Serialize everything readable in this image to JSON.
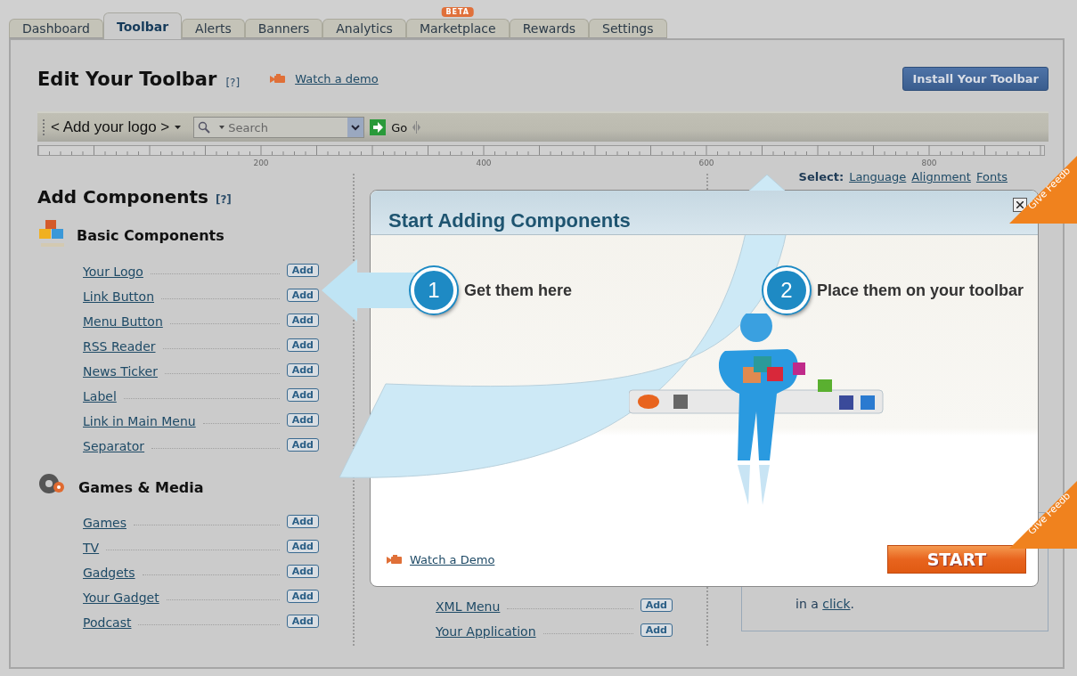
{
  "tabs": [
    {
      "label": "Dashboard",
      "selected": false
    },
    {
      "label": "Toolbar",
      "selected": true
    },
    {
      "label": "Alerts",
      "selected": false
    },
    {
      "label": "Banners",
      "selected": false
    },
    {
      "label": "Analytics",
      "selected": false
    },
    {
      "label": "Marketplace",
      "selected": false,
      "badge": "BETA"
    },
    {
      "label": "Rewards",
      "selected": false
    },
    {
      "label": "Settings",
      "selected": false
    }
  ],
  "header": {
    "title": "Edit Your Toolbar",
    "help": "[?]",
    "demo_link": "Watch a demo",
    "install_button": "Install Your Toolbar"
  },
  "toolbar_preview": {
    "logo": "< Add your logo >",
    "search_placeholder": "Search",
    "go": "Go"
  },
  "ruler": {
    "labels": [
      "200",
      "400",
      "600",
      "800"
    ]
  },
  "select_line": {
    "label": "Select:",
    "links": [
      "Language",
      "Alignment",
      "Fonts"
    ]
  },
  "components": {
    "title": "Add Components",
    "help": "[?]",
    "groups": [
      {
        "kind": "blocks",
        "title": "Basic Components",
        "items": [
          {
            "label": "Your Logo",
            "add": "Add"
          },
          {
            "label": "Link Button",
            "add": "Add"
          },
          {
            "label": "Menu Button",
            "add": "Add"
          },
          {
            "label": "RSS Reader",
            "add": "Add"
          },
          {
            "label": "News Ticker",
            "add": "Add"
          },
          {
            "label": "Label",
            "add": "Add"
          },
          {
            "label": "Link in Main Menu",
            "add": "Add"
          },
          {
            "label": "Separator",
            "add": "Add"
          }
        ]
      },
      {
        "kind": "film",
        "title": "Games & Media",
        "items": [
          {
            "label": "Games",
            "add": "Add"
          },
          {
            "label": "TV",
            "add": "Add"
          },
          {
            "label": "Gadgets",
            "add": "Add"
          },
          {
            "label": "Your Gadget",
            "add": "Add"
          },
          {
            "label": "Podcast",
            "add": "Add"
          }
        ]
      }
    ],
    "middle_items": [
      {
        "label": "XML Menu",
        "add": "Add"
      },
      {
        "label": "Your Application",
        "add": "Add"
      }
    ]
  },
  "info_box": {
    "before": "in a ",
    "link": "click",
    "after": "."
  },
  "modal": {
    "title": "Start Adding Components",
    "steps": [
      {
        "number": "1",
        "text": "Get them here"
      },
      {
        "number": "2",
        "text": "Place them on your toolbar"
      }
    ],
    "demo_link": "Watch a Demo",
    "start_button": "START"
  },
  "feedback_ribbons": [
    "Give Feedb",
    "Give Feedb"
  ]
}
